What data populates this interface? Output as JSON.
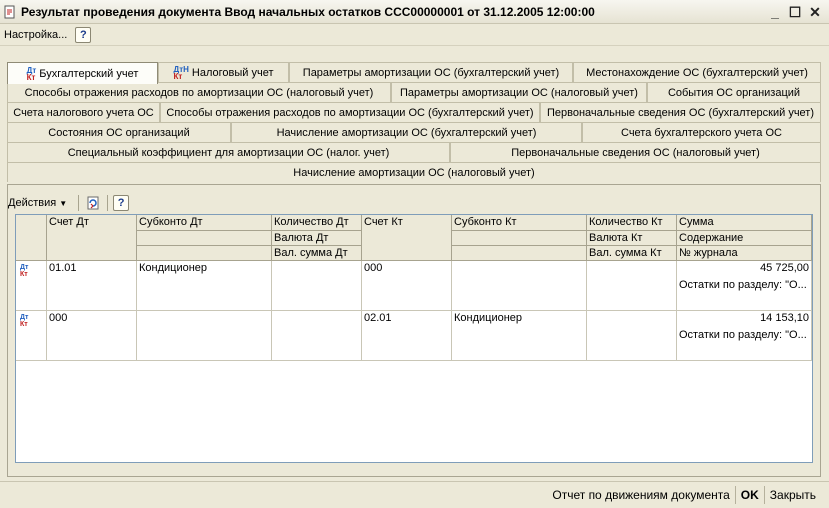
{
  "window": {
    "title": "Результат проведения документа Ввод начальных остатков ССС00000001 от 31.12.2005 12:00:00",
    "minimize": "_",
    "maximize": "☐",
    "close": "✕"
  },
  "menu": {
    "settings": "Настройка...",
    "help": "?"
  },
  "tabs": {
    "row1": [
      "Бухгалтерский учет",
      "Налоговый учет",
      "Параметры амортизации ОС (бухгалтерский учет)",
      "Местонахождение ОС (бухгалтерский учет)"
    ],
    "row2": [
      "Способы отражения расходов по амортизации ОС (налоговый учет)",
      "Параметры амортизации ОС (налоговый учет)",
      "События ОС организаций"
    ],
    "row3": [
      "Счета налогового учета ОС",
      "Способы отражения расходов по амортизации ОС (бухгалтерский учет)",
      "Первоначальные сведения ОС (бухгалтерский учет)"
    ],
    "row4": [
      "Состояния ОС организаций",
      "Начисление амортизации ОС (бухгалтерский учет)",
      "Счета бухгалтерского учета ОС"
    ],
    "row5": [
      "Специальный коэффициент для амортизации ОС (налог. учет)",
      "Первоначальные сведения ОС (налоговый учет)"
    ],
    "row6": [
      "Начисление амортизации ОС (налоговый учет)"
    ],
    "active": "Бухгалтерский учет",
    "icon_dt": "Дт",
    "icon_kt": "Кт",
    "icon_n": "Н"
  },
  "toolbar": {
    "actions": "Действия",
    "help": "?"
  },
  "table": {
    "headers": {
      "schet_dt": "Счет Дт",
      "subkonto_dt": "Субконто Дт",
      "kolichestvo_dt": "Количество Дт",
      "valyuta_dt": "Валюта Дт",
      "val_summa_dt": "Вал. сумма Дт",
      "schet_kt": "Счет Кт",
      "subkonto_kt": "Субконто Кт",
      "kolichestvo_kt": "Количество Кт",
      "valyuta_kt": "Валюта Кт",
      "val_summa_kt": "Вал. сумма Кт",
      "summa": "Сумма",
      "soderzhanie": "Содержание",
      "nomer_zhurnala": "№ журнала"
    },
    "rows": [
      {
        "schet_dt": "01.01",
        "subkonto_dt": "Кондиционер",
        "schet_kt": "000",
        "subkonto_kt": "",
        "summa": "45 725,00",
        "soderzhanie": "Остатки по разделу: \"О..."
      },
      {
        "schet_dt": "000",
        "subkonto_dt": "",
        "schet_kt": "02.01",
        "subkonto_kt": "Кондиционер",
        "summa": "14 153,10",
        "soderzhanie": "Остатки по разделу: \"О..."
      }
    ]
  },
  "status": {
    "report": "Отчет по движениям документа",
    "ok": "OK",
    "close": "Закрыть"
  },
  "colors": {
    "dt": "#1f5fbf",
    "kt": "#c02020",
    "background": "#ece9d8"
  }
}
